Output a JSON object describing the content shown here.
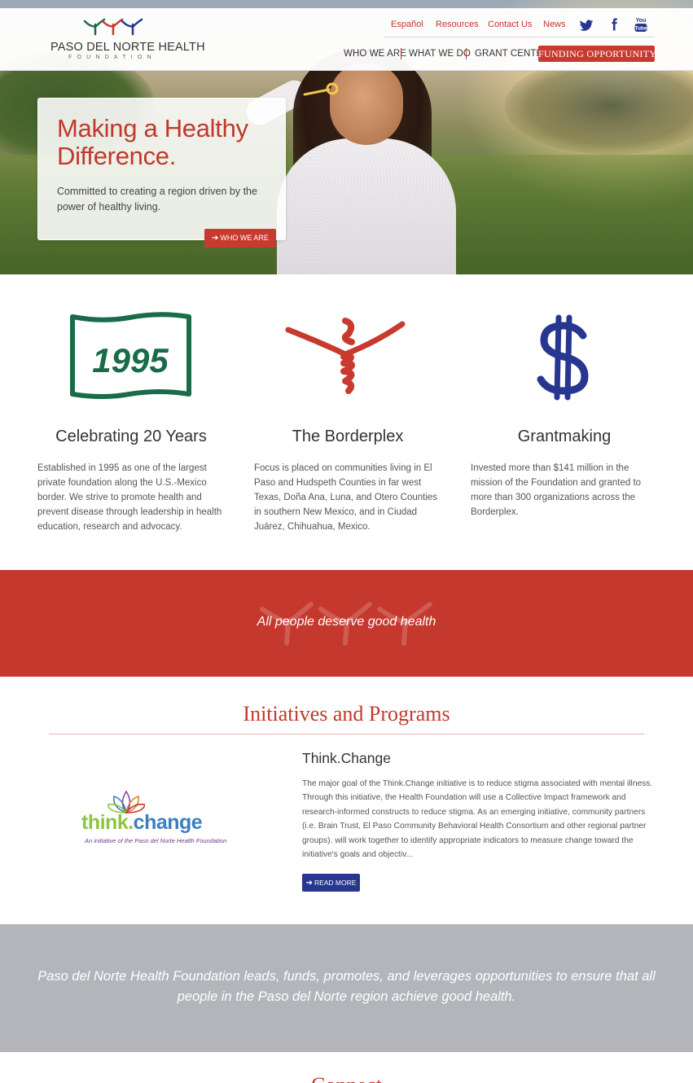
{
  "brand": {
    "name": "PASO DEL NORTE HEALTH",
    "sub": "FOUNDATION",
    "red": "#c83a2f",
    "green": "#1a6b4a",
    "blue": "#27378f"
  },
  "top_links": [
    "Español",
    "Resources",
    "Contact Us",
    "News"
  ],
  "social": {
    "twitter_icon": "twitter-icon",
    "facebook_icon": "facebook-icon",
    "youtube_icon": "youtube-icon",
    "youtube_label_1": "You",
    "youtube_label_2": "Tube"
  },
  "nav": {
    "items": [
      "WHO WE ARE",
      "WHAT WE DO",
      "GRANT CENTER"
    ],
    "cta": "FUNDING OPPORTUNITY"
  },
  "hero": {
    "title": "Making a Healthy Difference.",
    "text": "Committed to creating a region driven by the power of healthy living.",
    "button": "WHO WE ARE",
    "button_icon": "arrow-right-icon"
  },
  "features": [
    {
      "icon": "1995-badge-icon",
      "badge_text": "1995",
      "title": "Celebrating 20 Years",
      "text": "Established in 1995 as one of the largest private foundation along the U.S.-Mexico border. We strive to promote health and prevent disease through leadership in health education, research and advocacy."
    },
    {
      "icon": "borderplex-figure-icon",
      "title": "The Borderplex",
      "text": "Focus is placed on communities living in El Paso and Hudspeth Counties in far west Texas, Doña Ana, Luna, and Otero Counties in southern New Mexico, and in Ciudad Juárez, Chihuahua, Mexico."
    },
    {
      "icon": "dollar-sign-icon",
      "title": "Grantmaking",
      "text": "Invested more than $141 million in the mission of the Foundation and granted to more than 300 organizations across the Borderplex."
    }
  ],
  "slogan": "All people deserve good health",
  "initiatives": {
    "section_title": "Initiatives and Programs",
    "logo": {
      "word_think": "think",
      "word_dot": ".",
      "word_change": "change",
      "tagline": "An initiative of the Paso del Norte Health Foundation"
    },
    "program_title": "Think.Change",
    "program_text": "The major goal of the Think.Change initiative is to reduce stigma associated with mental illness. Through this initiative, the Health Foundation will use a Collective Impact framework and research-informed constructs to reduce stigma. As an emerging initiative, community partners (i.e. Brain Trust, El Paso Community Behavioral Health Consortium and other regional partner groups). will work together to identify appropriate indicators to measure change toward the initiative's goals and objectiv...",
    "button": "READ MORE"
  },
  "mission": "Paso del Norte Health Foundation leads, funds, promotes, and leverages opportunities to ensure that all people in the Paso del Norte region achieve good health.",
  "bottom_heading_partial": "Connect"
}
